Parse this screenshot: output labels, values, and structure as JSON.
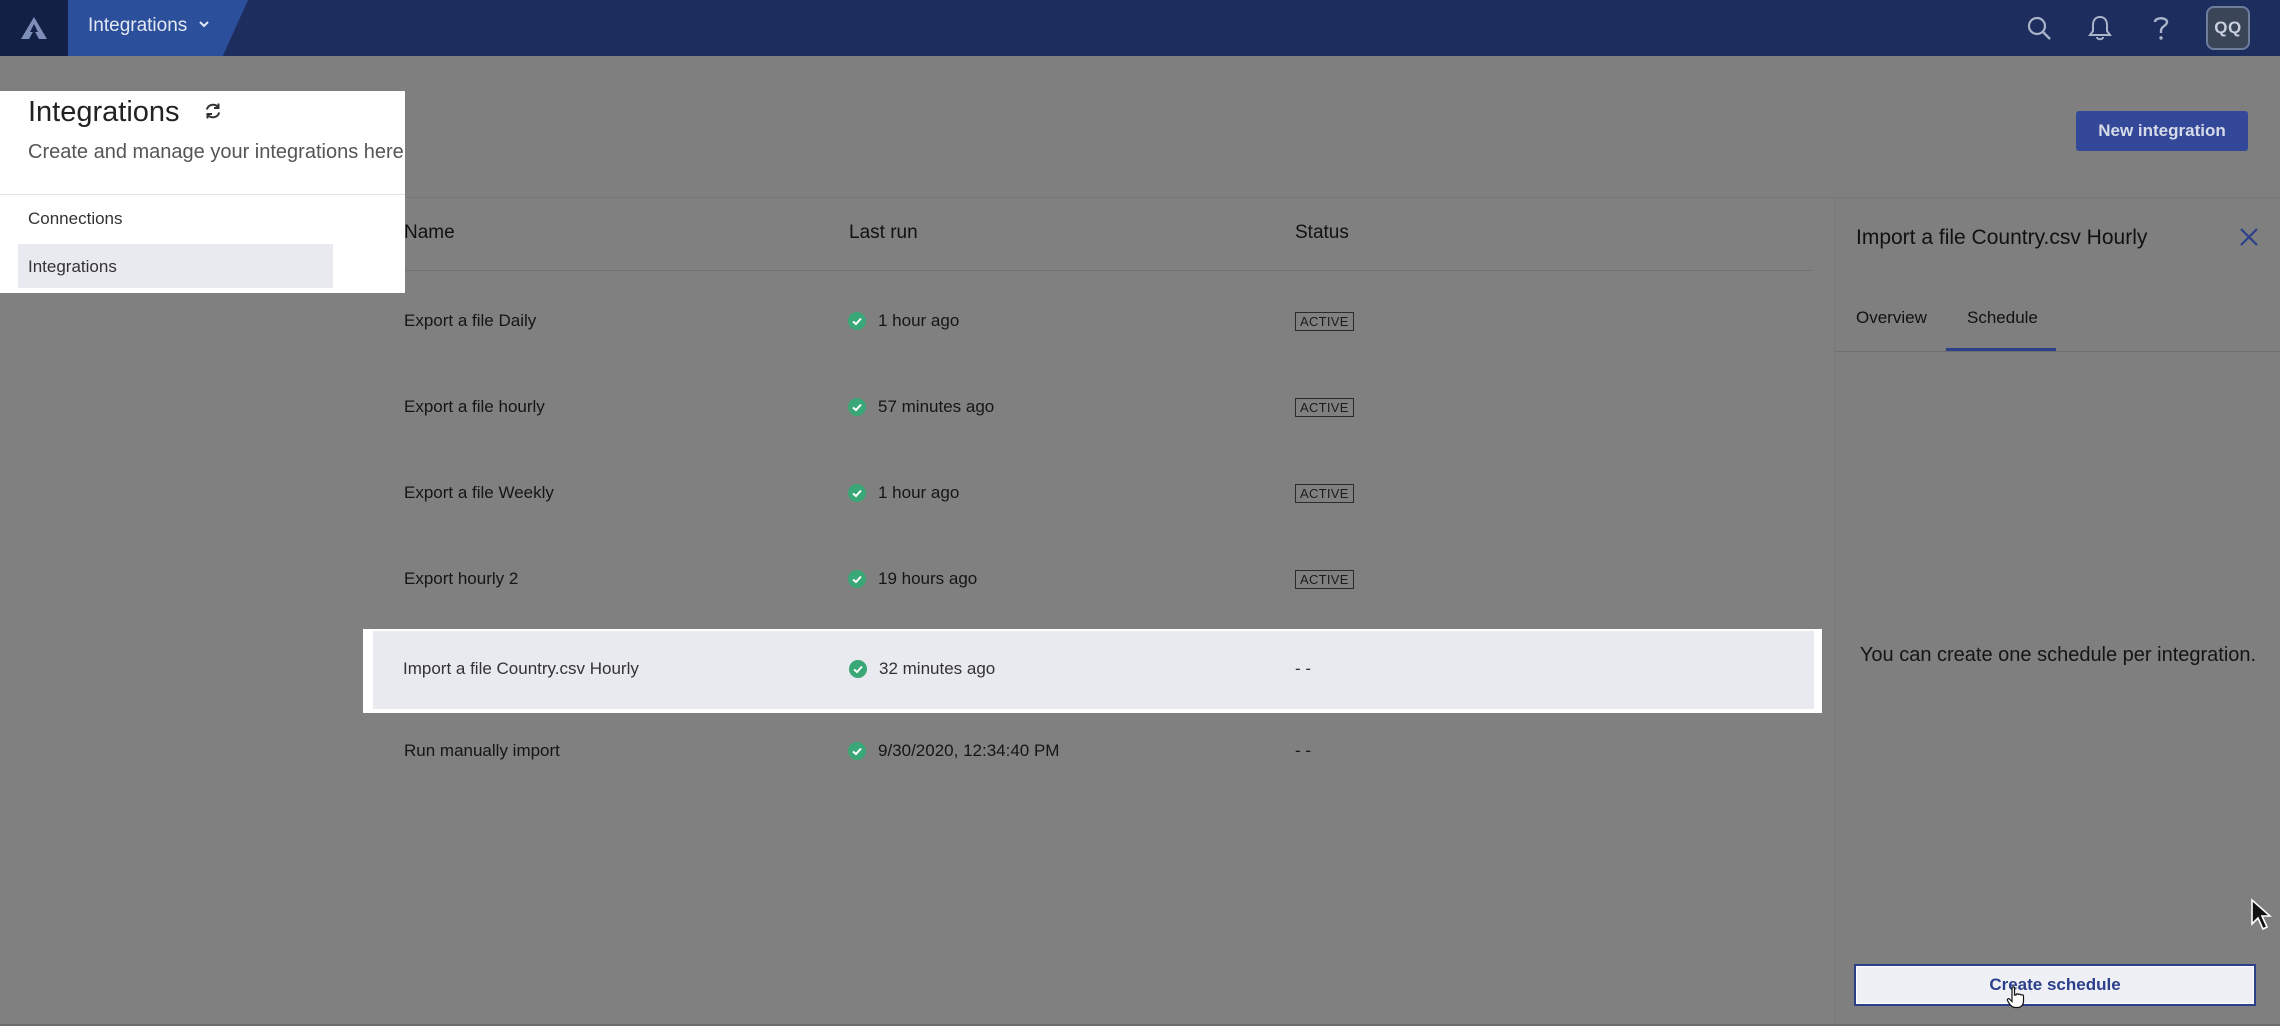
{
  "topbar": {
    "switcher_label": "Integrations",
    "avatar_initials": "QQ",
    "icons": [
      "app-logo-icon",
      "chevron-down-icon",
      "search-icon",
      "bell-icon",
      "help-icon"
    ]
  },
  "header": {
    "title": "Integrations",
    "subtitle": "Create and manage your integrations here",
    "new_button": "New integration"
  },
  "nav": {
    "connections": "Connections",
    "integrations": "Integrations"
  },
  "table": {
    "columns": [
      "Name",
      "Last run",
      "Status"
    ],
    "rows": [
      {
        "name": "Export a file Daily",
        "last_run": "1 hour ago",
        "status": "ACTIVE"
      },
      {
        "name": "Export a file hourly",
        "last_run": "57 minutes ago",
        "status": "ACTIVE"
      },
      {
        "name": "Export a file Weekly",
        "last_run": "1 hour ago",
        "status": "ACTIVE"
      },
      {
        "name": "Export hourly 2",
        "last_run": "19 hours ago",
        "status": "ACTIVE"
      },
      {
        "name": "Import a file Country.csv Hourly",
        "last_run": "32 minutes ago",
        "status": "- -"
      },
      {
        "name": "Run manually import",
        "last_run": "9/30/2020, 12:34:40 PM",
        "status": "- -"
      }
    ]
  },
  "panel": {
    "title": "Import a file Country.csv Hourly",
    "tabs": [
      "Overview",
      "Schedule"
    ],
    "active_tab": "Schedule",
    "message": "You can create one schedule per integration.",
    "create_button": "Create schedule"
  },
  "colors": {
    "topbar": "#1d2d5d",
    "accent": "#2c3f8a",
    "success": "#3aa876",
    "overlay": "#808080"
  }
}
